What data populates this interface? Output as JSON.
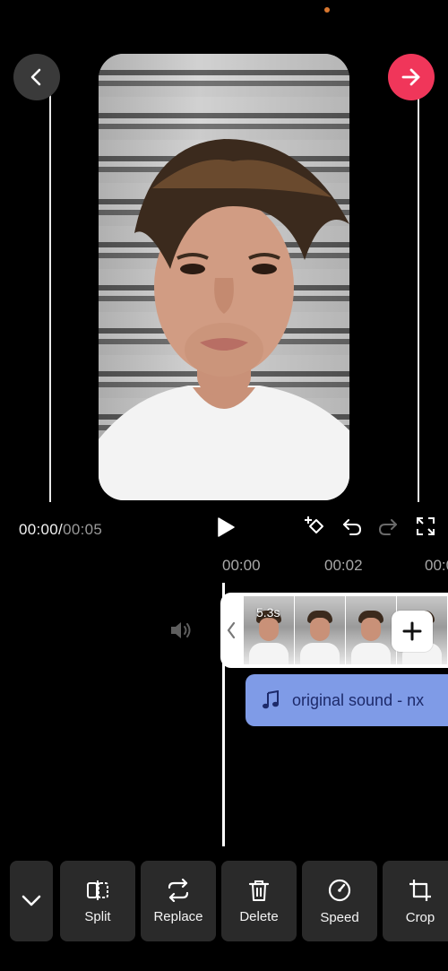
{
  "header": {
    "back_icon": "chevron-left-icon",
    "next_icon": "arrow-right-icon",
    "next_color": "#f0365a"
  },
  "preview": {
    "subject": "video-frame"
  },
  "playback": {
    "current_time": "00:00",
    "separator": "/",
    "total_time": "00:05",
    "play_icon": "play-icon",
    "keyframe_icon": "keyframe-add-icon",
    "undo_icon": "undo-icon",
    "redo_icon": "redo-icon",
    "fullscreen_icon": "fullscreen-icon"
  },
  "timeline": {
    "ruler": [
      "00:00",
      "00:02",
      "00:0"
    ],
    "video_clip": {
      "duration": "5.3s",
      "frame_count": 4
    },
    "add_icon": "plus-icon",
    "audio_track": {
      "icon": "music-note-icon",
      "label": "original sound - nx",
      "color": "#7f9be7"
    }
  },
  "toolbar": {
    "collapse_icon": "chevron-down-icon",
    "tools": [
      {
        "label": "Split",
        "icon": "split-icon"
      },
      {
        "label": "Replace",
        "icon": "replace-icon"
      },
      {
        "label": "Delete",
        "icon": "trash-icon"
      },
      {
        "label": "Speed",
        "icon": "speed-icon"
      },
      {
        "label": "Crop",
        "icon": "crop-icon"
      }
    ]
  }
}
